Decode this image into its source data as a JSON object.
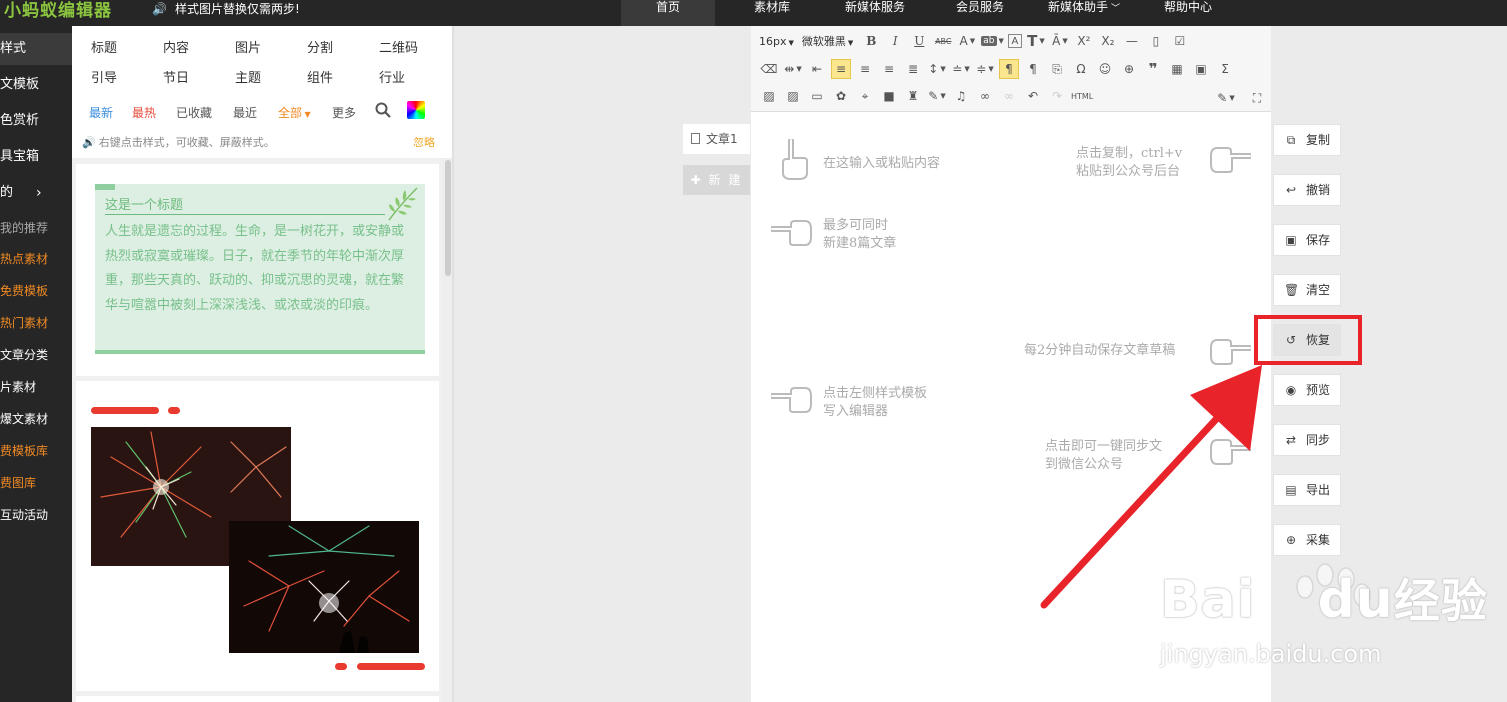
{
  "topbar": {
    "logo": "小蚂蚁编辑器",
    "notice": "样式图片替换仅需两步!",
    "nav": [
      {
        "label": "首页",
        "active": true
      },
      {
        "label": "素材库"
      },
      {
        "label": "新媒体服务"
      },
      {
        "label": "会员服务"
      },
      {
        "label": "新媒体助手"
      },
      {
        "label": "帮助中心"
      }
    ]
  },
  "sidebar": {
    "items": [
      {
        "label": "样式"
      },
      {
        "label": "文模板"
      },
      {
        "label": "色赏析"
      },
      {
        "label": "具宝箱"
      },
      {
        "label": "的"
      },
      {
        "label": "我的推荐"
      },
      {
        "label": "热点素材"
      },
      {
        "label": "免费模板"
      },
      {
        "label": "热门素材"
      },
      {
        "label": "文章分类"
      },
      {
        "label": "片素材"
      },
      {
        "label": "爆文素材"
      },
      {
        "label": "费模板库"
      },
      {
        "label": "费图库"
      },
      {
        "label": "互动活动"
      }
    ]
  },
  "panel": {
    "categories": [
      "标题",
      "内容",
      "图片",
      "分割",
      "二维码",
      "引导",
      "节日",
      "主题",
      "组件",
      "行业"
    ],
    "filters": [
      "最新",
      "最热",
      "已收藏",
      "最近",
      "全部",
      "更多"
    ],
    "tip": "右键点击样式，可收藏、屏蔽样式。",
    "ignore": "忽略",
    "template1": {
      "title": "这是一个标题",
      "body": "人生就是遗忘的过程。生命，是一树花开，或安静或热烈或寂寞或璀璨。日子，就在季节的年轮中渐次厚重，那些天真的、跃动的、抑或沉思的灵魂，就在繁华与喧嚣中被刻上深深浅浅、或浓或淡的印痕。"
    }
  },
  "articles": {
    "tab": "文章1",
    "new": "新 建"
  },
  "toolbar": {
    "font_size": "16px",
    "font_family": "微软雅黑",
    "html_label": "HTML"
  },
  "editor": {
    "hints": {
      "paste": "在这输入或粘贴内容",
      "copy_l1": "点击复制，ctrl+v",
      "copy_l2": "粘贴到公众号后台",
      "max_l1": "最多可同时",
      "max_l2": "新建8篇文章",
      "autosave": "每2分钟自动保存文章草稿",
      "template_l1": "点击左侧样式模板",
      "template_l2": "写入编辑器",
      "sync_l1": "点击即可一键同步文",
      "sync_l2": "到微信公众号"
    }
  },
  "actions": [
    {
      "label": "复制",
      "icon": "copy-icon"
    },
    {
      "label": "撤销",
      "icon": "undo-icon"
    },
    {
      "label": "保存",
      "icon": "save-icon"
    },
    {
      "label": "清空",
      "icon": "trash-icon"
    },
    {
      "label": "恢复",
      "icon": "restore-icon"
    },
    {
      "label": "预览",
      "icon": "eye-icon"
    },
    {
      "label": "同步",
      "icon": "sync-icon"
    },
    {
      "label": "导出",
      "icon": "export-icon"
    },
    {
      "label": "采集",
      "icon": "collect-icon"
    }
  ],
  "watermark": {
    "brand": "Bai",
    "brand2": "du",
    "cn": "经验",
    "url": "jingyan.baidu.com"
  },
  "colors": {
    "accent_red": "#e8232a",
    "logo_green": "#8bc53f",
    "template_green": "#dcefe2"
  }
}
